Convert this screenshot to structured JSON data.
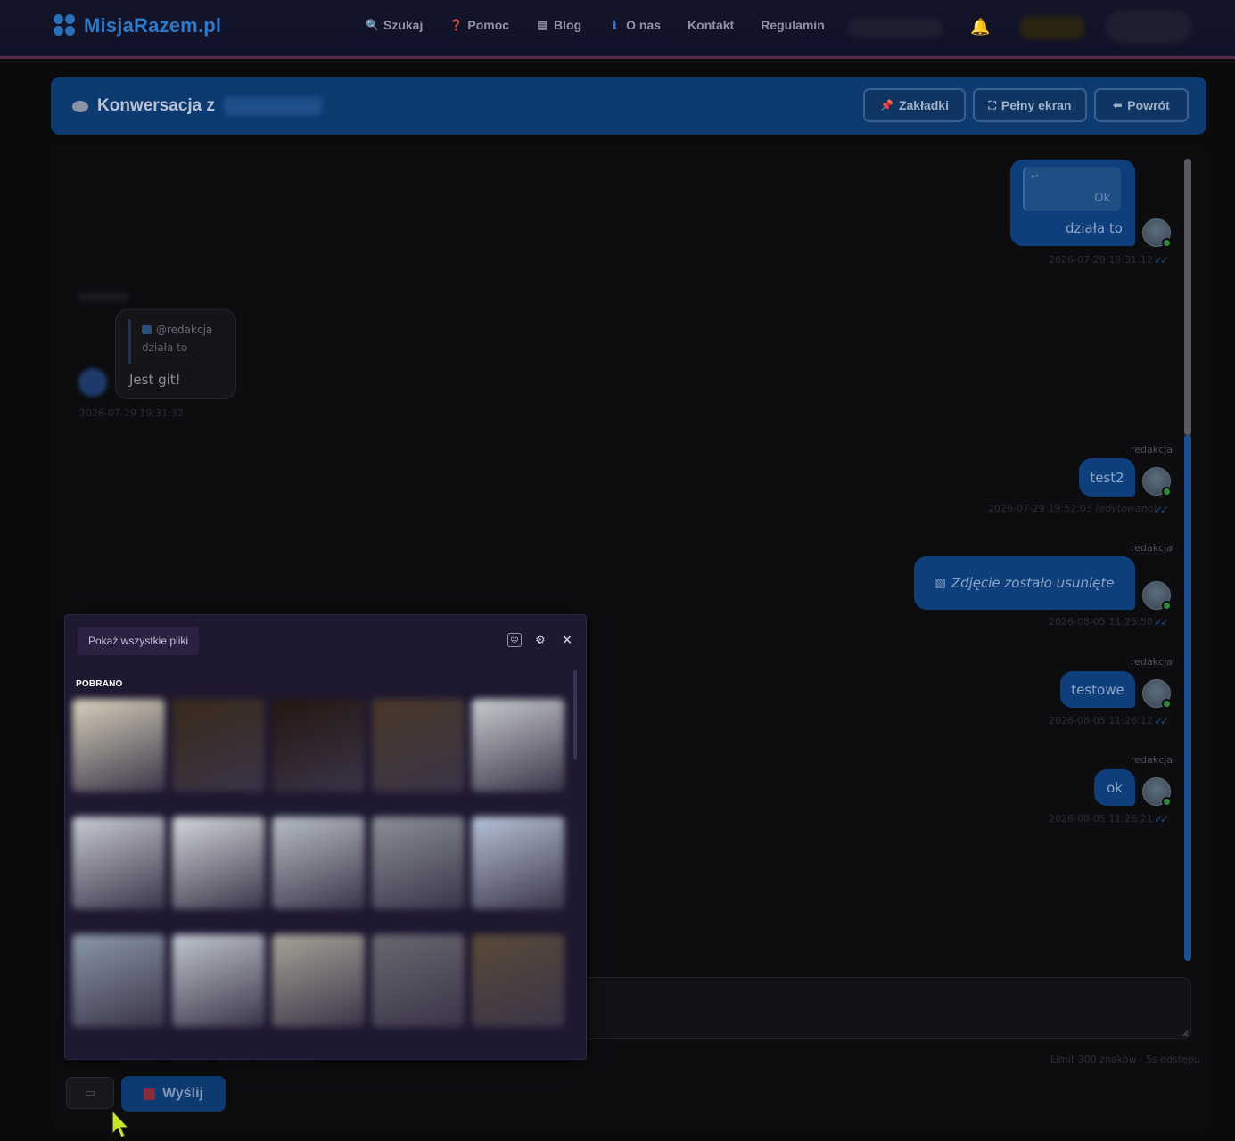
{
  "nav": {
    "logo": "MisjaRazem.pl",
    "items": [
      {
        "icon": "search-icon",
        "glyph": "🔍",
        "label": "Szukaj"
      },
      {
        "icon": "help-icon",
        "glyph": "❓",
        "label": "Pomoc"
      },
      {
        "icon": "blog-icon",
        "glyph": "▤",
        "label": "Blog"
      },
      {
        "icon": "info-icon",
        "glyph": "ℹ",
        "label": "O nas"
      },
      {
        "icon": "",
        "glyph": "",
        "label": "Kontakt"
      },
      {
        "icon": "",
        "glyph": "",
        "label": "Regulamin"
      }
    ]
  },
  "header": {
    "title_prefix": "Konwersacja z",
    "buttons": {
      "bookmarks": "Zakładki",
      "fullscreen": "Pełny ekran",
      "back": "Powrót"
    }
  },
  "messages": {
    "m1": {
      "quote": "Ok",
      "text": "działa to",
      "time": "2026-07-29 19:31:12"
    },
    "m2": {
      "quote_user": "@redakcja",
      "quote_text": "działa to",
      "text": "Jest git!",
      "time": "2026-07-29 19:31:32"
    },
    "m3": {
      "sender": "redakcja",
      "text": "test2",
      "time": "2026-07-29 19:52:03",
      "edited": "(edytowano)"
    },
    "m4": {
      "sender": "redakcja",
      "text": "Zdjęcie zostało usunięte",
      "time": "2026-08-05 11:25:50"
    },
    "m5": {
      "sender": "redakcja",
      "text": "testowe",
      "time": "2026-08-05 11:26:12"
    },
    "m6": {
      "sender": "redakcja",
      "text": "ok",
      "time": "2026-08-05 11:26:21"
    }
  },
  "picker": {
    "show_all": "Pokaż wszystkie pliki",
    "section": "POBRANO",
    "thumb_colors": [
      "#d8d2bc",
      "#3a2a1a",
      "#241610",
      "#4a3828",
      "#c8ccd0",
      "#c8ccd4",
      "#d4d8dc",
      "#b8c0c8",
      "#8a9098",
      "#b8c4d8",
      "#8a98a8",
      "#c0c8d0",
      "#a8a498",
      "#6a6870",
      "#5a4a38"
    ]
  },
  "composer": {
    "limit": "Limit 300 znaków · 5s odstępu",
    "send": "Wyślij"
  },
  "colors": {
    "accent": "#0d3a70",
    "brand": "#2f79c6"
  }
}
